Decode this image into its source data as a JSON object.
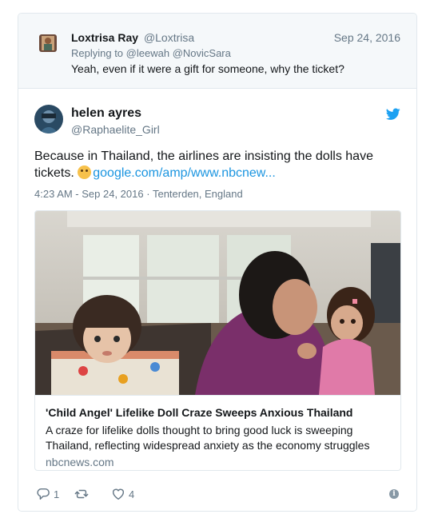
{
  "reply": {
    "name": "Loxtrisa Ray",
    "handle": "@Loxtrisa",
    "date": "Sep 24, 2016",
    "replying_prefix": "Replying to",
    "replying_to": [
      "@leewah",
      "@NovicSara"
    ],
    "text": "Yeah, even if it were a gift for someone, why the ticket?",
    "avatar_icon": "profile-photo"
  },
  "tweet": {
    "name": "helen ayres",
    "handle": "@Raphaelite_Girl",
    "text": "Because in Thailand, the airlines are insisting the dolls have tickets.",
    "emoji": "flushed-face-emoji",
    "link": "google.com/amp/www.nbcnew...",
    "timestamp": "4:23 AM - Sep 24, 2016",
    "location": "Tenterden, England",
    "brand_icon": "twitter-bird-icon",
    "brand_color": "#1da1f2",
    "link_color": "#1b95e0"
  },
  "link_card": {
    "title": "'Child Angel' Lifelike Doll Craze Sweeps Anxious Thailand",
    "description": "A craze for lifelike dolls thought to bring good luck is sweeping Thailand, reflecting widespread anxiety as the economy struggles",
    "domain": "nbcnews.com"
  },
  "actions": {
    "reply_count": "1",
    "retweet_count": "",
    "like_count": "4"
  }
}
